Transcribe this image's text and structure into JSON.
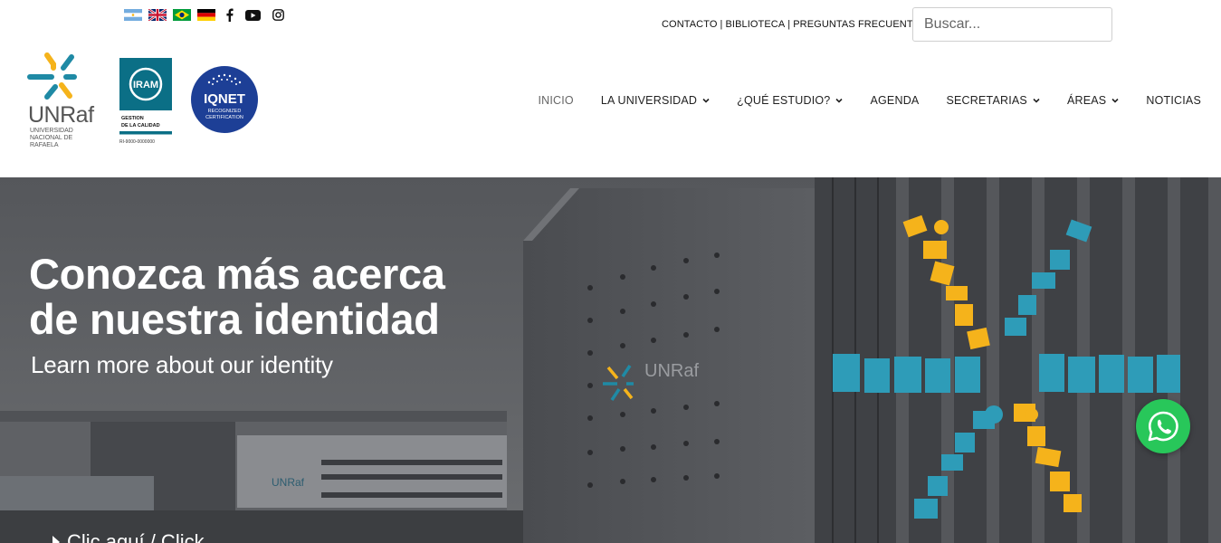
{
  "topbar": {
    "flags": [
      "argentina-flag",
      "uk-flag",
      "brazil-flag",
      "germany-flag"
    ],
    "social": [
      "facebook-icon",
      "youtube-icon",
      "instagram-icon"
    ],
    "links": [
      {
        "label": "CONTACTO"
      },
      {
        "label": "BIBLIOTECA"
      },
      {
        "label": "PREGUNTAS FRECUENTES"
      }
    ],
    "separator": "|",
    "search_placeholder": "Buscar..."
  },
  "logos": {
    "unraf_name": "UNRaf",
    "unraf_sub": [
      "UNIVERSIDAD",
      "NACIONAL DE",
      "RAFAELA"
    ],
    "iram_name": "IRAM",
    "iram_sub": [
      "GESTION",
      "DE LA CALIDAD"
    ],
    "iram_code": "RI-9000-0000000",
    "iqnet_name": "IQNET",
    "iqnet_sub": [
      "RECOGNIZED",
      "CERTIFICATION"
    ]
  },
  "nav": [
    {
      "label": "INICIO",
      "dropdown": false,
      "active": true
    },
    {
      "label": "LA UNIVERSIDAD",
      "dropdown": true
    },
    {
      "label": "¿QUÉ ESTUDIO?",
      "dropdown": true
    },
    {
      "label": "AGENDA",
      "dropdown": false
    },
    {
      "label": "SECRETARIAS",
      "dropdown": true
    },
    {
      "label": "ÁREAS",
      "dropdown": true
    },
    {
      "label": "NOTICIAS",
      "dropdown": false
    }
  ],
  "hero": {
    "title_line1": "Conozca más acerca",
    "title_line2": "de nuestra identidad",
    "subtitle": "Learn more about our identity",
    "cta": "Clic aquí / Click",
    "building_sign": "UNRaf",
    "building_sign_small": "UNIVERSIDAD NACIONAL DE RAFAELA",
    "small_building_sign": "UNRaf"
  },
  "colors": {
    "brand_teal": "#1f8aa5",
    "brand_yellow": "#f5b31b",
    "iqnet_blue": "#1d3f96",
    "whatsapp_green": "#28c75a"
  }
}
